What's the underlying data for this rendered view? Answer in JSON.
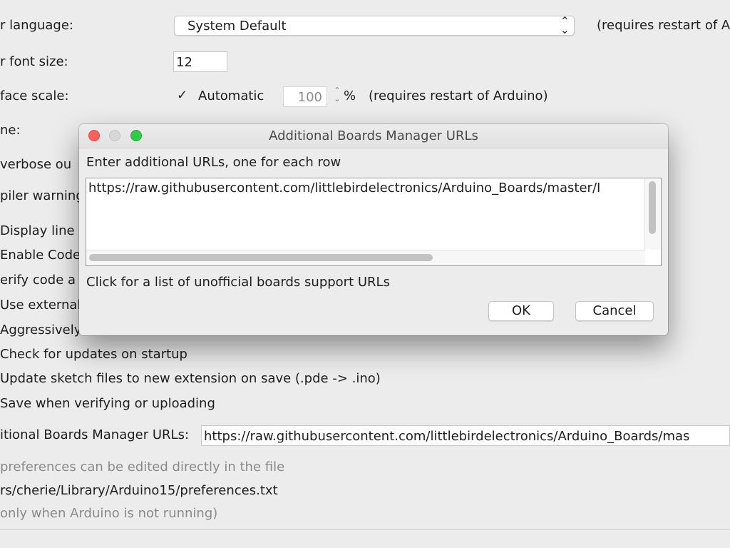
{
  "prefs": {
    "language_label": "r language:",
    "language_value": "System Default",
    "language_note": "(requires restart of A",
    "font_size_label": "r font size:",
    "font_size_value": "12",
    "scale_label": "face scale:",
    "scale_automatic_label": "Automatic",
    "scale_value": "100",
    "scale_percent": "%",
    "scale_note": "(requires restart of Arduino)",
    "theme_label": "ne:",
    "verbose_label": "verbose ou",
    "compiler_label": "piler warning",
    "checkboxes": [
      "Display line n",
      "Enable Code",
      "erify code a",
      "Use external",
      "Aggressively",
      "Check for updates on startup",
      "Update sketch files to new extension on save (.pde -> .ino)",
      "Save when verifying or uploading"
    ],
    "boards_urls_label": "itional Boards Manager URLs:",
    "boards_urls_value": "https://raw.githubusercontent.com/littlebirdelectronics/Arduino_Boards/mas",
    "more_prefs_text": "preferences can be edited directly in the file",
    "prefs_path": "rs/cherie/Library/Arduino15/preferences.txt",
    "not_running_text": "only when Arduino is not running)"
  },
  "dialog": {
    "title": "Additional Boards Manager URLs",
    "instruction": "Enter additional URLs, one for each row",
    "urls_text": "https://raw.githubusercontent.com/littlebirdelectronics/Arduino_Boards/master/I",
    "unofficial_link": "Click for a list of unofficial boards support URLs",
    "ok_label": "OK",
    "cancel_label": "Cancel"
  },
  "icons": {
    "select_arrows": "up-down-chevron-icon",
    "checkmark": "checkmark-icon",
    "spinner": "spinner-arrows-icon"
  },
  "colors": {
    "close": "#fc605c",
    "minimize_disabled": "#d7d7d7",
    "zoom": "#34c84a"
  }
}
